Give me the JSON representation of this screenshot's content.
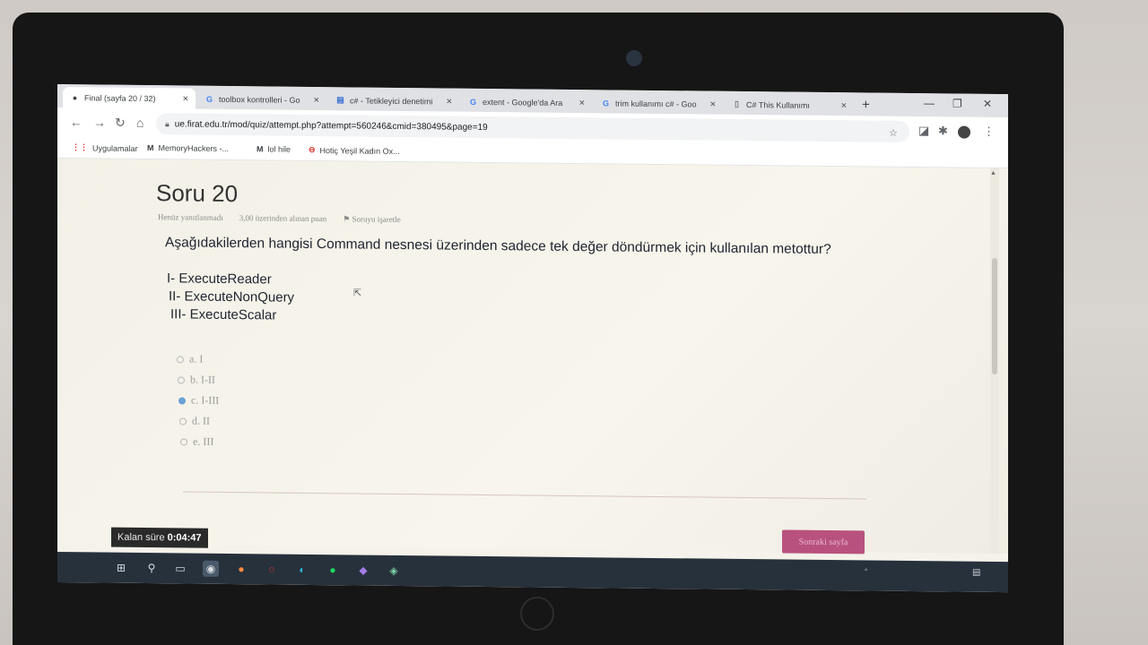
{
  "browser": {
    "tabs": [
      {
        "title": "Final (sayfa 20 / 32)",
        "icon": "moodle-icon",
        "active": true
      },
      {
        "title": "toolbox kontrolleri - Go",
        "icon": "google-icon"
      },
      {
        "title": "c# - Tetikleyici denetimi",
        "icon": "stackoverflow-icon"
      },
      {
        "title": "extent - Google'da Ara",
        "icon": "google-icon"
      },
      {
        "title": "trim kullanımı c# - Goo",
        "icon": "google-icon"
      },
      {
        "title": "C# This Kullanımı",
        "icon": "page-icon"
      }
    ],
    "url": "ue.firat.edu.tr/mod/quiz/attempt.php?attempt=560246&cmid=380495&page=19",
    "bookmarks": [
      {
        "label": "Uygulamalar",
        "icon": "apps-grid-icon"
      },
      {
        "label": "MemoryHackers -...",
        "icon": "m-logo-icon"
      },
      {
        "label": "lol hile",
        "icon": "m-logo-icon"
      },
      {
        "label": "Hotiç Yeşil Kadın Ox...",
        "icon": "hotic-icon"
      }
    ]
  },
  "quiz": {
    "title": "Soru 20",
    "status": "Henüz yanıtlanmadı",
    "points": "3,00 üzerinden alınan puan",
    "flag_label": "Soruyu işaretle",
    "question": "Aşağıdakilerden hangisi Command nesnesi üzerinden sadece tek değer döndürmek için kullanılan metottur?",
    "statements": [
      "I- ExecuteReader",
      "II- ExecuteNonQuery",
      "III- ExecuteScalar"
    ],
    "options": [
      {
        "label": "a. I",
        "selected": false
      },
      {
        "label": "b. I-II",
        "selected": false
      },
      {
        "label": "c. I-III",
        "selected": true
      },
      {
        "label": "d. II",
        "selected": false
      },
      {
        "label": "e. III",
        "selected": false
      }
    ],
    "next_button": "Sonraki sayfa",
    "timer_label": "Kalan süre",
    "timer_value": "0:04:47"
  },
  "taskbar": {
    "apps": [
      "windows-start-icon",
      "search-icon",
      "task-view-icon",
      "chrome-icon",
      "firefox-icon",
      "opera-icon",
      "edge-icon",
      "spotify-icon",
      "visual-studio-icon",
      "app-icon"
    ]
  },
  "colors": {
    "next_button": "#b9517e",
    "selected_radio": "#6aa0d8",
    "taskbar": "#27313c"
  }
}
